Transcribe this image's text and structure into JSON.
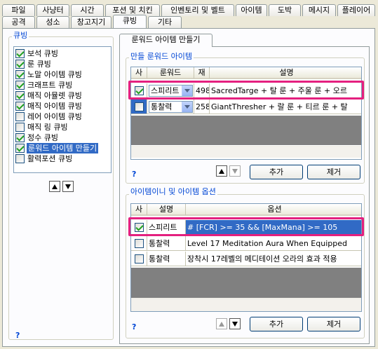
{
  "tabs_row1": [
    "파일",
    "사냥터",
    "시간",
    "포션 및 치킨",
    "인벤토리 및 벨트",
    "아이템",
    "도박",
    "메시지",
    "플레이어"
  ],
  "tabs_row2": [
    "공격",
    "성소",
    "창고지기",
    "큐빙",
    "기타"
  ],
  "active_tab": "큐빙",
  "cubing_group": {
    "title": "큐빙",
    "items": [
      {
        "label": "보석 큐빙",
        "checked": true
      },
      {
        "label": "룬 큐빙",
        "checked": true
      },
      {
        "label": "노말 아이템 큐빙",
        "checked": true
      },
      {
        "label": "크래프트 큐빙",
        "checked": true
      },
      {
        "label": "매직 아뮬렛 큐빙",
        "checked": true
      },
      {
        "label": "매직 아이템 큐빙",
        "checked": true
      },
      {
        "label": "레어 아이템 큐빙",
        "checked": false
      },
      {
        "label": "매직 링 큐빙",
        "checked": false
      },
      {
        "label": "정수 큐빙",
        "checked": true
      },
      {
        "label": "룬워드 아이템 만들기",
        "checked": true,
        "selected": true
      },
      {
        "label": "활력포션 큐빙",
        "checked": false
      }
    ],
    "help": "?"
  },
  "subtab": "룬워드 아이템 만들기",
  "runeword_group": {
    "title": "만들 룬워드 아이템",
    "headers": [
      "사",
      "룬워드",
      "재",
      "설명"
    ],
    "rows": [
      {
        "checked": true,
        "type": "스피리트",
        "num": "498",
        "desc": "SacredTarge + 탈 룬 + 주울 룬 + 오르"
      },
      {
        "checked": false,
        "type": "통찰력",
        "num": "258",
        "desc": "GiantThresher + 랄 룬 + 티르 룬 + 탈"
      }
    ],
    "add_label": "추가",
    "remove_label": "제거",
    "help": "?"
  },
  "itemoption_group": {
    "title": "아이템이니 및 아이템 옵션",
    "headers": [
      "사",
      "설명",
      "옵션"
    ],
    "rows": [
      {
        "checked": true,
        "desc": "스피리트",
        "option": "# [FCR] >= 35 && [MaxMana] >= 105"
      },
      {
        "checked": false,
        "desc": "통찰력",
        "option": "Level 17 Meditation Aura When Equipped"
      },
      {
        "checked": false,
        "desc": "통찰력",
        "option": "장착시 17레벨의 메디테이션 오라의 효과 적용"
      }
    ],
    "add_label": "추가",
    "remove_label": "제거",
    "help": "?"
  },
  "help_bottom": "?",
  "colors": {
    "highlight": "#E4207F",
    "selection": "#316AC5",
    "group_title": "#0046D5"
  }
}
